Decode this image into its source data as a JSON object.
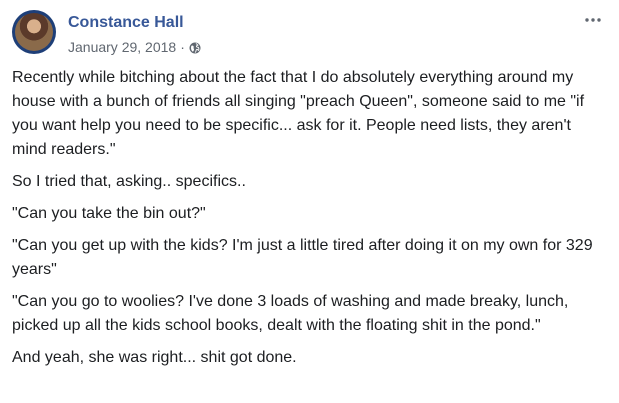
{
  "post": {
    "author": "Constance Hall",
    "date": "January 29, 2018",
    "separator": "·",
    "privacy_icon": "globe-icon",
    "more_icon": "more-options-icon",
    "paragraphs": [
      "Recently while bitching about the fact that I do absolutely everything around my house with a bunch of friends all singing \"preach Queen\", someone said to me \"if you want help you need to be specific... ask for it. People need lists, they aren't mind readers.\"",
      "So I tried that, asking.. specifics..",
      "\"Can you take the bin out?\"",
      "\"Can you get up with the kids? I'm just a little tired after doing it on my own for 329 years\"",
      "\"Can you go to woolies? I've done 3 loads of washing and made breaky, lunch, picked up all the kids school books, dealt with the floating shit in the pond.\"",
      "And yeah, she was right... shit got done."
    ]
  },
  "colors": {
    "author_link": "#385898",
    "meta_text": "#606770",
    "body_text": "#1c1e21",
    "avatar_ring": "#1e3f78"
  }
}
